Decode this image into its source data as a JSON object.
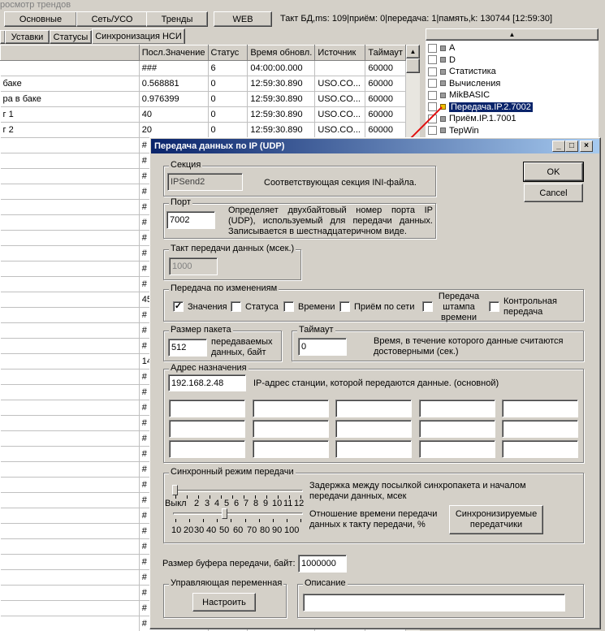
{
  "window": {
    "caption": "росмотр трендов"
  },
  "toolbar": {
    "buttons": [
      "Основные",
      "Сеть/УСО",
      "Тренды",
      "WEB"
    ],
    "status": "Такт БД,ms: 109|приём: 0|передача: 1|память,k: 130744 [12:59:30]"
  },
  "tabs": [
    "Уставки",
    "Статусы",
    "Синхронизация НСИ"
  ],
  "table": {
    "headers": [
      "Посл.Значение",
      "Статус",
      "Время обновл.",
      "Источник",
      "Таймаут"
    ],
    "rows": [
      {
        "name": "",
        "value": "###",
        "status": "6",
        "time": "04:00:00.000",
        "source": "",
        "timeout": "60000"
      },
      {
        "name": "баке",
        "value": "0.568881",
        "status": "0",
        "time": "12:59:30.890",
        "source": "USO.CO...",
        "timeout": "60000"
      },
      {
        "name": "ра в баке",
        "value": "0.976399",
        "status": "0",
        "time": "12:59:30.890",
        "source": "USO.CO...",
        "timeout": "60000"
      },
      {
        "name": "г 1",
        "value": "40",
        "status": "0",
        "time": "12:59:30.890",
        "source": "USO.CO...",
        "timeout": "60000"
      },
      {
        "name": "г 2",
        "value": "20",
        "status": "0",
        "time": "12:59:30.890",
        "source": "USO.CO...",
        "timeout": "60000"
      }
    ],
    "partial_values": [
      "#",
      "#",
      "#",
      "#",
      "#",
      "#",
      "#",
      "#",
      "#",
      "#",
      "45",
      "#",
      "#",
      "#",
      "14",
      "#",
      "#",
      "#",
      "#",
      "#",
      "#",
      "#",
      "#",
      "#",
      "#",
      "#",
      "#",
      "#",
      "#",
      "#",
      "#",
      "#"
    ]
  },
  "tree": {
    "items": [
      {
        "label": "A",
        "icon": "module-icon"
      },
      {
        "label": "D",
        "icon": "module-icon"
      },
      {
        "label": "Статистика",
        "icon": "module-icon"
      },
      {
        "label": "Вычисления",
        "icon": "module-icon"
      },
      {
        "label": "MikBASIC",
        "icon": "module-icon"
      },
      {
        "label": "Передача.IP.2.7002",
        "icon": "module-icon",
        "selected": true
      },
      {
        "label": "Приём.IP.1.7001",
        "icon": "module-icon"
      },
      {
        "label": "TepWin",
        "icon": "module-icon"
      }
    ]
  },
  "dialog": {
    "title": "Передача данных по IP (UDP)",
    "ok": "OK",
    "cancel": "Cancel",
    "section": {
      "title": "Секция",
      "value": "IPSend2",
      "desc": "Соответствующая секция INI-файла."
    },
    "port": {
      "title": "Порт",
      "value": "7002",
      "desc": "Определяет двухбайтовый номер порта IP (UDP), используемый для передачи данных. Записывается в шестнадцатеричном виде."
    },
    "tact": {
      "title": "Такт передачи данных (мсек.)",
      "value": "1000"
    },
    "changes": {
      "title": "Передача по изменениям",
      "values": "Значения",
      "status": "Статуса",
      "time": "Времени",
      "net": "Приём по сети",
      "stamp": "Передача штампа времени",
      "control": "Контрольная передача"
    },
    "packet": {
      "title": "Размер пакета",
      "value": "512",
      "desc": "передаваемых данных, байт"
    },
    "timeout": {
      "title": "Таймаут",
      "value": "0",
      "desc": "Время, в течение которого данные считаются достоверными (сек.)"
    },
    "address": {
      "title": "Адрес назначения",
      "value": "192.168.2.48",
      "desc": "IP-адрес станции, которой передаются данные. (основной)"
    },
    "sync": {
      "title": "Синхронный режим передачи",
      "delay_desc": "Задержка между посылкой синхропакета и началом передачи данных, мсек",
      "delay_scale": [
        "Выкл",
        "2",
        "3",
        "4",
        "5",
        "6",
        "7",
        "8",
        "9",
        "10",
        "11",
        "12"
      ],
      "ratio_desc": "Отношение времени передачи данных к такту передачи, %",
      "ratio_scale": [
        "10",
        "20",
        "30",
        "40",
        "50",
        "60",
        "70",
        "80",
        "90",
        "100"
      ],
      "sync_button": "Синхронизируемые передатчики"
    },
    "buffer": {
      "label": "Размер буфера передачи, байт:",
      "value": "1000000"
    },
    "control_var": {
      "title": "Управляющая переменная",
      "button": "Настроить"
    },
    "description": {
      "title": "Описание",
      "value": ""
    }
  }
}
